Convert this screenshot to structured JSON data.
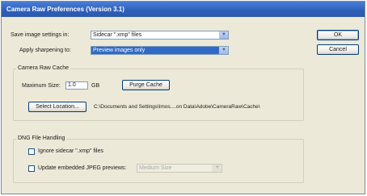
{
  "window": {
    "title": "Camera Raw Preferences  (Version 3.1)"
  },
  "save_settings": {
    "label": "Save image settings in:",
    "value": "Sidecar \".xmp\" files"
  },
  "sharpening": {
    "label": "Apply sharpening to:",
    "value": "Preview images only"
  },
  "buttons": {
    "ok": "OK",
    "cancel": "Cancel"
  },
  "cache": {
    "group_label": "Camera Raw Cache",
    "max_size_label": "Maximum Size:",
    "max_size_value": "1.0",
    "unit": "GB",
    "purge_label": "Purge Cache",
    "select_location_label": "Select Location...",
    "path": "C:\\Documents and Settings\\lmos....on Data\\Adobe\\CameraRaw\\Cache\\"
  },
  "dng": {
    "group_label": "DNG File Handling",
    "ignore_sidecar_label": "Ignore sidecar \".xmp\" files",
    "ignore_sidecar_checked": false,
    "update_jpeg_label": "Update embedded JPEG previews:",
    "update_jpeg_checked": false,
    "preview_size_value": "Medium Size"
  }
}
